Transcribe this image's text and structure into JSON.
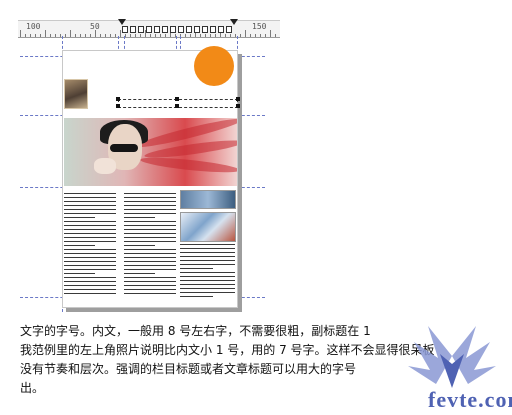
{
  "ruler": {
    "labels": {
      "left": "100",
      "mid": "50",
      "right": "150"
    }
  },
  "article": {
    "avatar_label": "profile photo",
    "hero_label": "hero photo",
    "thumb1_label": "thumbnail",
    "thumb2_label": "thumbnail"
  },
  "text": {
    "line1": "文字的字号。内文，一般用 8 号左右字，不需要很粗，副标题在 1",
    "line2": "我范例里的左上角照片说明比内文小 1 号，用的 7 号字。这样不会显得很呆板",
    "line3": "没有节奏和层次。强调的栏目标题或者文章标题可以用大的字号",
    "line4": "出。"
  },
  "watermark": {
    "text": "fevte.com",
    "color": "#4f62b3"
  },
  "colors": {
    "accent": "#f28a17",
    "guide": "#6b79c7"
  }
}
